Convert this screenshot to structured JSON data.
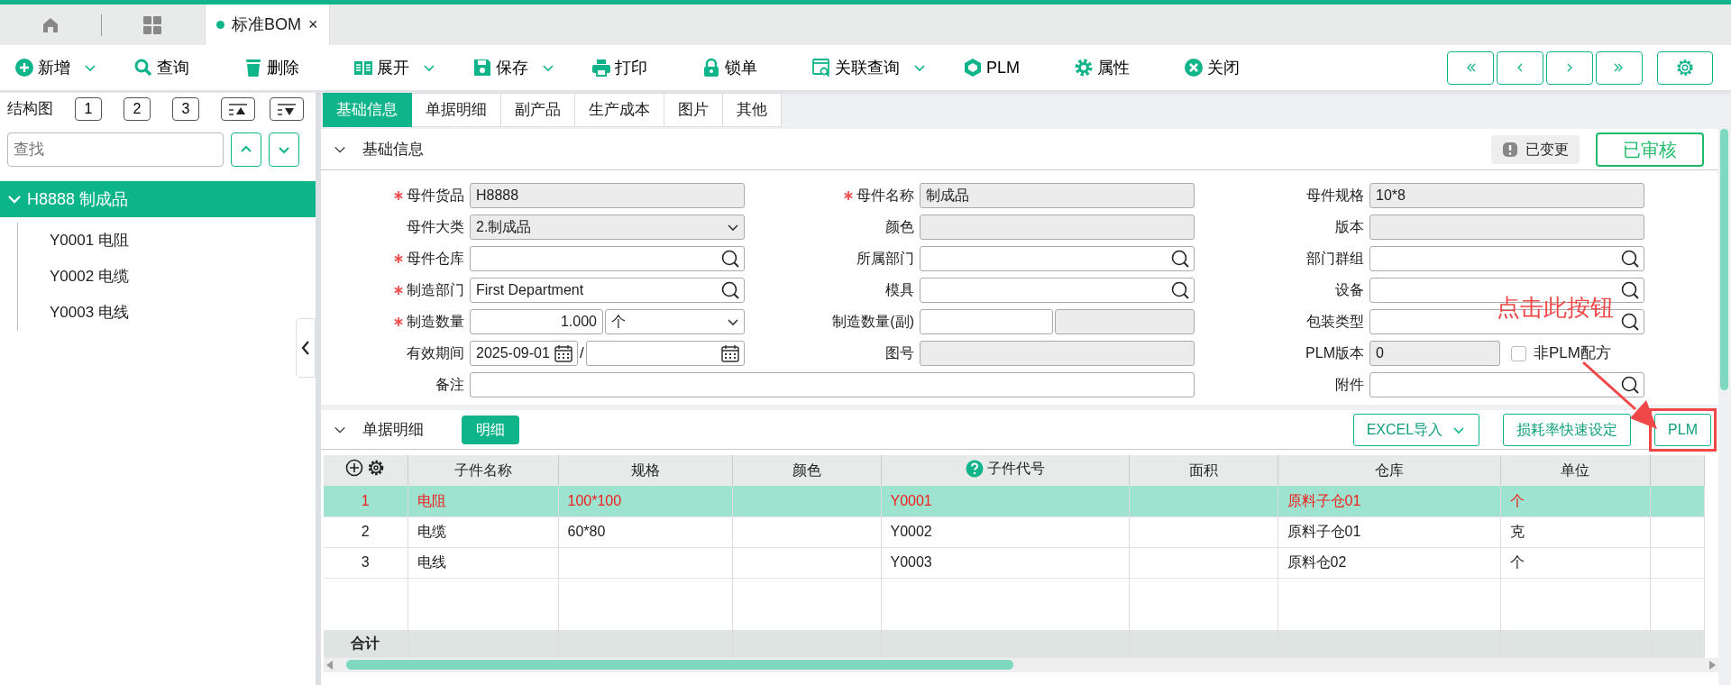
{
  "doc_tabs": [
    {
      "label": "标准BOM",
      "close": "×",
      "selected": true
    }
  ],
  "toolbar": [
    {
      "label": "新增",
      "dropdown": true
    },
    {
      "label": "查询",
      "dropdown": false
    },
    {
      "label": "删除",
      "dropdown": false
    },
    {
      "label": "展开",
      "dropdown": true
    },
    {
      "label": "保存",
      "dropdown": true
    },
    {
      "label": "打印",
      "dropdown": false
    },
    {
      "label": "锁单",
      "dropdown": false
    },
    {
      "label": "关联查询",
      "dropdown": true
    },
    {
      "label": "PLM",
      "dropdown": false
    },
    {
      "label": "属性",
      "dropdown": false
    },
    {
      "label": "关闭",
      "dropdown": false
    }
  ],
  "tree": {
    "title": "结构图",
    "levels": [
      "1",
      "2",
      "3"
    ],
    "search": {
      "placeholder": "查找"
    },
    "items": [
      {
        "label": "H8888 制成品",
        "expanded": true,
        "selected": true,
        "children": [
          {
            "label": "Y0001 电阻",
            "selected": false
          },
          {
            "label": "Y0002 电缆",
            "selected": false
          },
          {
            "label": "Y0003 电线",
            "selected": false
          }
        ]
      }
    ]
  },
  "form_tabs": [
    {
      "label": "基础信息",
      "selected": true
    },
    {
      "label": "单据明细",
      "selected": false
    },
    {
      "label": "副产品",
      "selected": false
    },
    {
      "label": "生产成本",
      "selected": false
    },
    {
      "label": "图片",
      "selected": false
    },
    {
      "label": "其他",
      "selected": false
    }
  ],
  "basic_section": {
    "title": "基础信息",
    "expanded": true,
    "changed_badge": "已变更",
    "status": "已审核",
    "fields": [
      {
        "kind": "text",
        "label": "母件货品",
        "required": true,
        "value": "H8888",
        "readonly": true
      },
      {
        "kind": "text",
        "label": "母件名称",
        "required": true,
        "value": "制成品",
        "readonly": true
      },
      {
        "kind": "text",
        "label": "母件规格",
        "required": false,
        "value": "10*8",
        "readonly": true
      },
      {
        "kind": "select",
        "label": "母件大类",
        "required": false,
        "value": "2.制成品",
        "readonly": true
      },
      {
        "kind": "text",
        "label": "颜色",
        "required": false,
        "readonly": true
      },
      {
        "kind": "text",
        "label": "版本",
        "required": false,
        "readonly": true
      },
      {
        "kind": "lookup",
        "label": "母件仓库",
        "required": true
      },
      {
        "kind": "lookup",
        "label": "所属部门",
        "required": false
      },
      {
        "kind": "lookup",
        "label": "部门群组",
        "required": false
      },
      {
        "kind": "lookup",
        "label": "制造部门",
        "required": true,
        "value": "First Department"
      },
      {
        "kind": "lookup",
        "label": "模具",
        "required": false
      },
      {
        "kind": "lookup",
        "label": "设备",
        "required": false
      },
      {
        "kind": "quantity",
        "label": "制造数量",
        "required": true,
        "value": "1.000",
        "unit": "个"
      },
      {
        "kind": "pair",
        "label": "制造数量(副)",
        "required": false
      },
      {
        "kind": "lookup",
        "label": "包装类型",
        "required": false
      },
      {
        "kind": "date_range",
        "label": "有效期间",
        "required": false,
        "value": "2025-09-01",
        "separator": "/"
      },
      {
        "kind": "text",
        "label": "图号",
        "required": false,
        "readonly": true
      },
      {
        "kind": "version",
        "label": "PLM版本",
        "required": false,
        "value": "0",
        "readonly": true,
        "option": {
          "label": "非PLM配方",
          "checked": false
        }
      },
      {
        "kind": "wide",
        "label": "备注",
        "required": false
      },
      {
        "kind": "lookup",
        "label": "附件",
        "required": false
      }
    ]
  },
  "detail_section": {
    "title": "单据明细",
    "expanded": true,
    "tab": "明细",
    "buttons": [
      {
        "label": "EXCEL导入",
        "dropdown": true,
        "highlighted": false
      },
      {
        "label": "损耗率快速设定",
        "dropdown": false,
        "highlighted": false
      },
      {
        "label": "PLM",
        "dropdown": false,
        "highlighted": true
      }
    ],
    "table": {
      "columns": [
        {
          "label": "子件名称",
          "help": false
        },
        {
          "label": "规格",
          "help": false
        },
        {
          "label": "颜色",
          "help": false
        },
        {
          "label": "子件代号",
          "help": true
        },
        {
          "label": "面积",
          "help": false
        },
        {
          "label": "仓库",
          "help": false
        },
        {
          "label": "单位",
          "help": false
        }
      ],
      "rows": [
        {
          "selected": true,
          "number": "1",
          "cells": [
            "电阻",
            "100*100",
            "",
            "Y0001",
            "",
            "原料子仓01",
            "个"
          ]
        },
        {
          "selected": false,
          "number": "2",
          "cells": [
            "电缆",
            "60*80",
            "",
            "Y0002",
            "",
            "原料子仓01",
            "克"
          ]
        },
        {
          "selected": false,
          "number": "3",
          "cells": [
            "电线",
            "",
            "",
            "Y0003",
            "",
            "原料仓02",
            "个"
          ]
        }
      ],
      "footer": "合计"
    }
  },
  "annotation": {
    "text": "点击此按钮"
  }
}
